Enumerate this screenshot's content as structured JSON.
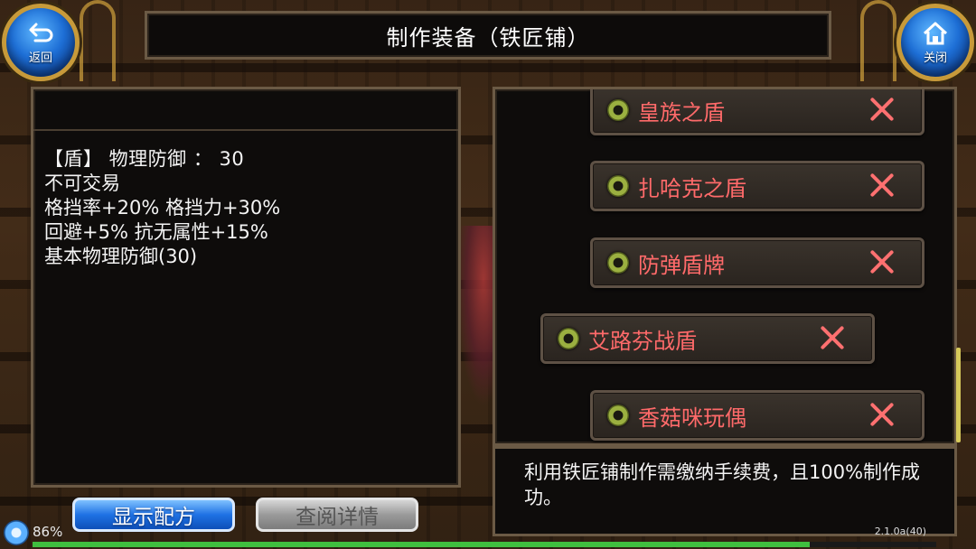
{
  "header": {
    "title": "制作装备（铁匠铺）",
    "back_label": "返回",
    "close_label": "关闭"
  },
  "item": {
    "lines": [
      "【盾】 物理防御 ：  30",
      "不可交易",
      "格挡率+20% 格挡力+30%",
      "回避+5% 抗无属性+15%",
      "基本物理防御(30)"
    ]
  },
  "recipes": [
    {
      "name": "皇族之盾",
      "selected": false
    },
    {
      "name": "扎哈克之盾",
      "selected": false
    },
    {
      "name": "防弹盾牌",
      "selected": false
    },
    {
      "name": "艾路芬战盾",
      "selected": true
    },
    {
      "name": "香菇咪玩偶",
      "selected": false
    }
  ],
  "info": {
    "text": "利用铁匠铺制作需缴纳手续费，且100%制作成功。"
  },
  "buttons": {
    "show_recipe": "显示配方",
    "view_details": "查阅详情"
  },
  "status": {
    "battery": "86%",
    "version": "2.1.0a(40)",
    "progress": 0.86
  },
  "colors": {
    "recipe_name": "#ff6a6a",
    "primary_button": "#1f72e4",
    "panel_border": "#6b5a45"
  }
}
